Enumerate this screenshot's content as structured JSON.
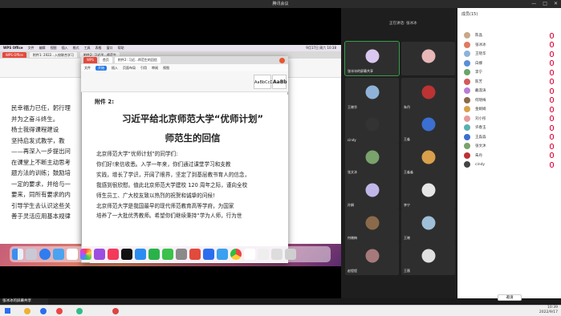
{
  "window": {
    "title": "腾讯会议",
    "controls": [
      "—",
      "□",
      "✕"
    ]
  },
  "share": {
    "banner": "",
    "presenter_label": "张冰冰的屏幕共享"
  },
  "mac": {
    "menubar": [
      "WPS Office",
      "文件",
      "编辑",
      "视图",
      "插入",
      "格式",
      "工具",
      "表格",
      "窗口",
      "帮助"
    ],
    "menubar_right": "9月17日 周六 10:38"
  },
  "back_doc": {
    "tabs": [
      "WPS Office",
      "附件1: 2022...入校联合学习",
      "附件2: 习近平...师范生"
    ],
    "text_lines": [
      "民幸福力已任，躬行理",
      "并为之奋斗终生。",
      "   杨士我得课程建设",
      "坚持启发式教学，教",
      "——再深入一步提出问",
      "在课堂上不断主动思考",
      "题方法的训练；鼓励培",
      "一定的要求，并给与一",
      "要来，同所有要求的内",
      "引导学生去认识这些关",
      "善于灵活应用基本规律"
    ]
  },
  "front_doc": {
    "tabs": [
      "WPS",
      "首页",
      "附件2: 习近...师范生的回信"
    ],
    "menu": [
      "文件",
      "开始",
      "插入",
      "页面布局",
      "引用",
      "审阅",
      "视图"
    ],
    "active_menu": "开始",
    "style_samples": [
      "AaBbCcDd",
      "AaBb"
    ],
    "appendix": "附件 2:",
    "title_line1": "习近平给北京师范大学“优师计划”",
    "title_line2": "师范生的回信",
    "body": [
      "北京师范大学“优师计划”的同学们:",
      "    你们好!来信收悉。入学一年来，你们通过课堂学习和支教",
      "实践，增长了学识，开阔了眼界，坚定了到基层教书育人的信念，",
      "我感到很欣慰。值此北京师范大学建校 120 周年之际，谨向全校",
      "师生员工、广大校友致以热烈的祝贺和诚挚的问候!",
      "    北京师范大学是我国最早的现代师范教育高等学府，为国家",
      "培养了一大批优秀教师。希望你们继续秉持“学为人师，行为世"
    ]
  },
  "video": {
    "speaking_label": "正在讲话: 张冰冰",
    "tiles": [
      {
        "name": "张冰冰的屏幕共享",
        "color": "#d9c7f0"
      },
      {
        "name": "",
        "color": "#e8b7b7"
      },
      {
        "name": "王晓华",
        "color": "#8fb3d8"
      },
      {
        "name": "朱丹",
        "color": "#b33"
      },
      {
        "name": "cindy",
        "color": "#333"
      },
      {
        "name": "王淼",
        "color": "#3b6fd1"
      },
      {
        "name": "张文沐",
        "color": "#7aa26c"
      },
      {
        "name": "王淼淼",
        "color": "#d8a04a"
      },
      {
        "name": "孙娟",
        "color": "#c0b7e8"
      },
      {
        "name": "李宁",
        "color": "#e6e6e6"
      },
      {
        "name": "何晓梅",
        "color": "#8a6a4a"
      },
      {
        "name": "王晓",
        "color": "#9fbfd8"
      },
      {
        "name": "赵程程",
        "color": "#a67a7a"
      },
      {
        "name": "王薇",
        "color": "#e0e0e0"
      }
    ]
  },
  "members": {
    "header": "成员(15)",
    "list": [
      {
        "name": "陈晶",
        "color": "#c8a88a"
      },
      {
        "name": "张冰冰",
        "color": "#e07a5f"
      },
      {
        "name": "王晓华",
        "color": "#8fb3d8"
      },
      {
        "name": "白娜",
        "color": "#5a8fd8"
      },
      {
        "name": "李宁",
        "color": "#6aa56a"
      },
      {
        "name": "陈芳",
        "color": "#d25a5a"
      },
      {
        "name": "戴淑涛",
        "color": "#b77fd8"
      },
      {
        "name": "何晓梅",
        "color": "#8a6a4a"
      },
      {
        "name": "金娟娟",
        "color": "#d8a04a"
      },
      {
        "name": "刘小彤",
        "color": "#e69a9a"
      },
      {
        "name": "许春玉",
        "color": "#5ab0b0"
      },
      {
        "name": "王淼淼",
        "color": "#3b6fd1"
      },
      {
        "name": "张文沐",
        "color": "#7aa26c"
      },
      {
        "name": "朱丹",
        "color": "#b33"
      },
      {
        "name": "cindy",
        "color": "#444"
      }
    ],
    "invite_label": "邀请"
  },
  "taskbar": {
    "time": "10:39",
    "date": "2022/9/17"
  }
}
